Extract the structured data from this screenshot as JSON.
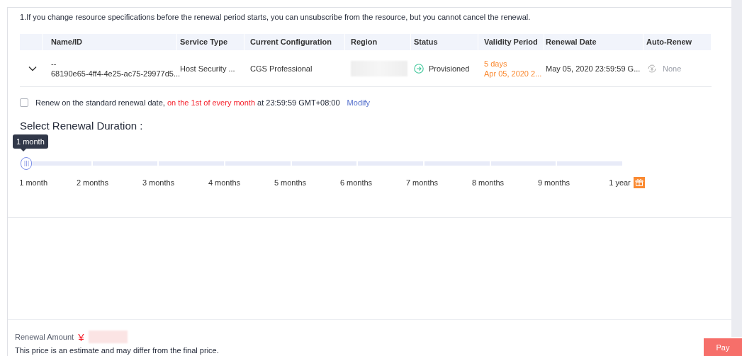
{
  "notice": "1.If you change resource specifications before the renewal period starts, you can unsubscribe from the resource, but you cannot cancel the renewal.",
  "table": {
    "columns": [
      "Name/ID",
      "Service Type",
      "Current Configuration",
      "Region",
      "Status",
      "Validity Period",
      "Renewal Date",
      "Auto-Renew"
    ],
    "rows": [
      {
        "expanded": false,
        "name": "--",
        "id": "68190e65-4ff4-4e25-ac75-29977d5...",
        "service_type": "Host Security ...",
        "configuration": "CGS Professional",
        "region_redacted": true,
        "status": "Provisioned",
        "validity_remaining": "5 days",
        "validity_end": "Apr 05, 2020 2...",
        "renewal_date": "May 05, 2020 23:59:59 G...",
        "auto_renew": "None"
      }
    ]
  },
  "standard_renewal": {
    "checked": false,
    "text": "Renew on the standard renewal date, ",
    "highlight": "on the 1st of every month",
    "suffix": " at 23:59:59 GMT+08:00",
    "link": "Modify"
  },
  "duration": {
    "title": "Select Renewal Duration :",
    "tooltip": "1 month",
    "level": 0,
    "stops": [
      {
        "label": "1 month",
        "gift": false
      },
      {
        "label": "2 months",
        "gift": false
      },
      {
        "label": "3 months",
        "gift": false
      },
      {
        "label": "4 months",
        "gift": false
      },
      {
        "label": "5 months",
        "gift": false
      },
      {
        "label": "6 months",
        "gift": false
      },
      {
        "label": "7 months",
        "gift": false
      },
      {
        "label": "8 months",
        "gift": false
      },
      {
        "label": "9 months",
        "gift": false
      },
      {
        "label": "1 year",
        "gift": true
      }
    ]
  },
  "footer": {
    "amount_label": "Renewal Amount",
    "currency": "¥",
    "amount_redacted": true,
    "note": "This price is an estimate and may differ from the final price.",
    "pay": "Pay"
  }
}
